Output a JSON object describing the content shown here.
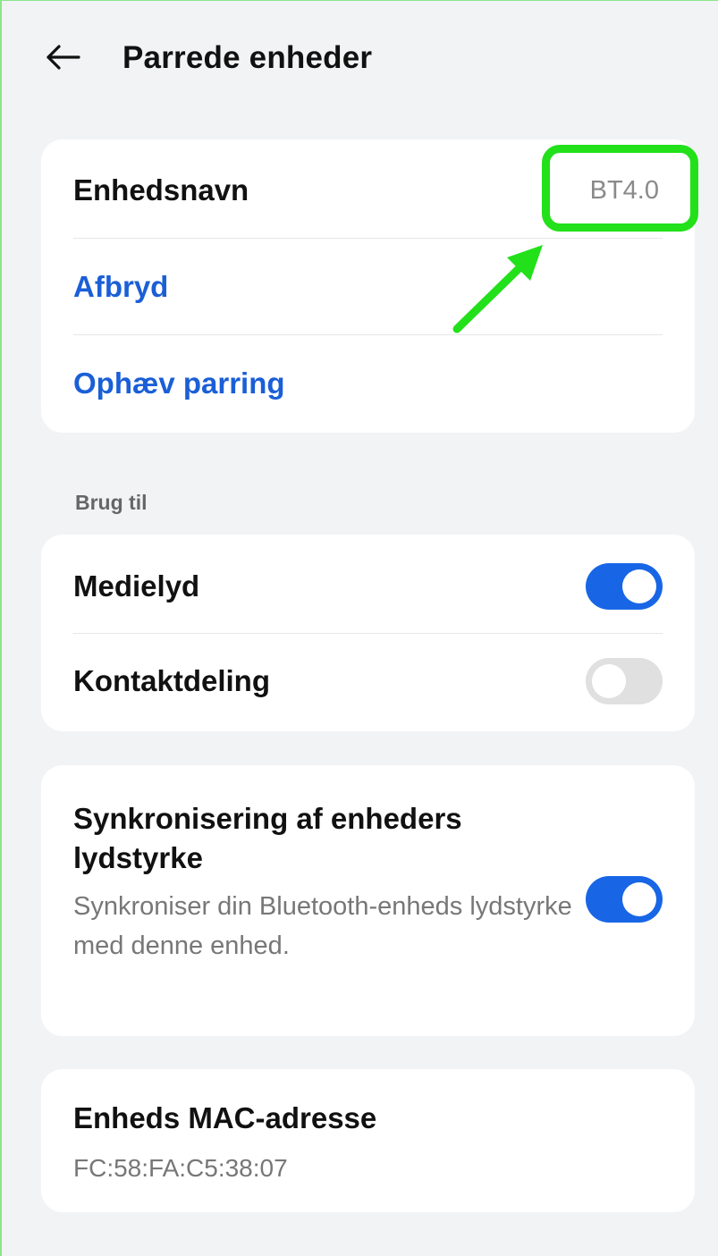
{
  "header": {
    "back_icon": "arrow-left-icon",
    "title": "Parrede enheder"
  },
  "device_card": {
    "name_label": "Enhedsnavn",
    "name_value": "BT4.0",
    "disconnect_label": "Afbryd",
    "unpair_label": "Ophæv parring"
  },
  "use_for": {
    "section_title": "Brug til",
    "media_audio": {
      "label": "Medielyd",
      "enabled": true
    },
    "contact_sharing": {
      "label": "Kontaktdeling",
      "enabled": false
    }
  },
  "volume_sync": {
    "title": "Synkronisering af enheders lydstyrke",
    "description": "Synkroniser din Bluetooth-enheds lydstyrke med denne enhed.",
    "enabled": true
  },
  "mac_card": {
    "label": "Enheds MAC-adresse",
    "value": "FC:58:FA:C5:38:07"
  },
  "annotation": {
    "highlight_color": "#22e01a"
  },
  "colors": {
    "accent": "#1a5fd6",
    "toggle_on": "#1866e6",
    "toggle_off": "#e0e0e0",
    "background": "#f2f3f5"
  }
}
